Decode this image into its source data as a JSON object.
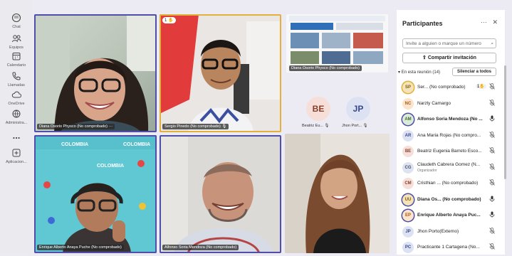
{
  "rail": [
    {
      "label": "Chat",
      "icon": "chat-icon"
    },
    {
      "label": "Equipos",
      "icon": "teams-icon"
    },
    {
      "label": "Calendario",
      "icon": "calendar-icon"
    },
    {
      "label": "Llamadas",
      "icon": "phone-icon"
    },
    {
      "label": "OneDrive",
      "icon": "cloud-icon"
    },
    {
      "label": "Administra...",
      "icon": "admin-icon"
    },
    {
      "label": "...",
      "icon": "more-icon"
    },
    {
      "label": "Aplicacion...",
      "icon": "apps-icon"
    }
  ],
  "tiles": {
    "diana": "Diana Osorio Physco (No comprobado)",
    "diana_more": "···",
    "sergio": "Sergio Pinedo (No comprobado)",
    "sergio_badge": "1",
    "share": "Diana Osorio Physco (No comprobado)",
    "enrique": "Enrique Alberto Anaya Puche (No comprobado)",
    "alfonso": "Alfonso Soria Mendoza (No comprobado)",
    "banner_word": "COLOMBIA"
  },
  "mini": [
    {
      "initials": "BE",
      "name": "Beatriz Eu..."
    },
    {
      "initials": "JP",
      "name": "Jhon Port..."
    }
  ],
  "panel": {
    "title": "Participantes",
    "more": "···",
    "close": "✕",
    "search_placeholder": "Invite a alguien o marque un número",
    "share_label": "Compartir invitación",
    "in_meeting": "En esta reunión (14)",
    "silence_all": "Silenciar a todos",
    "participants": [
      {
        "initials": "SP",
        "name": "Ser... (No comprobado)",
        "hand": "1",
        "bg": "#f3e3b6",
        "fg": "#7a5d12",
        "ring": "#e2b13c"
      },
      {
        "initials": "NC",
        "name": "Narzly Camargo",
        "bg": "#fbe3cc",
        "fg": "#a65a17"
      },
      {
        "initials": "AM",
        "name": "Alfonso Soria Mendoza (No ...",
        "bold": true,
        "bg": "#dcebd9",
        "fg": "#3a6a2c",
        "ring": "#4f4ea9"
      },
      {
        "initials": "AR",
        "name": "Ana Maria Rojas (No compro...",
        "bg": "#dde2f3",
        "fg": "#37478e"
      },
      {
        "initials": "BE",
        "name": "Beatriz Eugenia Barreto Esco...",
        "bg": "#f5dfd8",
        "fg": "#8a3e28"
      },
      {
        "initials": "CG",
        "name": "Claudeth Cabrera Gomez (N...",
        "sub": "Organizador",
        "bg": "#dfe3ef",
        "fg": "#3f4a73"
      },
      {
        "initials": "CM",
        "name": "Cristhian ... (No comprobado)",
        "bg": "#f5dfd8",
        "fg": "#8a3e28"
      },
      {
        "initials": "UU",
        "name": "Diana Os... (No comprobado)",
        "bold": true,
        "bg": "#f3e3b6",
        "fg": "#7a5d12",
        "ring": "#4f4ea9"
      },
      {
        "initials": "EP",
        "name": "Enrique Alberto Anaya Puc...",
        "bold": true,
        "bg": "#fbe3cc",
        "fg": "#a65a17",
        "ring": "#4f4ea9"
      },
      {
        "initials": "JP",
        "name": "Jhon Porto(Externo)",
        "bg": "#dde2f3",
        "fg": "#37478e"
      },
      {
        "initials": "PC",
        "name": "Practicante 1 Cartagena (No...",
        "bg": "#dde2f3",
        "fg": "#37478e"
      }
    ]
  }
}
